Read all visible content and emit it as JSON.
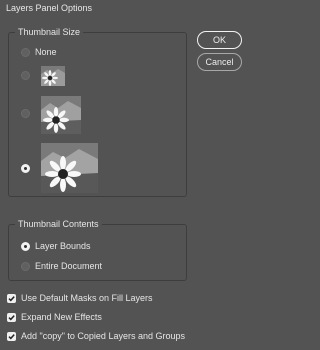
{
  "window": {
    "title": "Layers Panel Options"
  },
  "buttons": {
    "ok": "OK",
    "cancel": "Cancel"
  },
  "thumbnail_size": {
    "legend": "Thumbnail Size",
    "options": [
      {
        "label": "None",
        "selected": false
      },
      {
        "label": "",
        "selected": false,
        "size": "small"
      },
      {
        "label": "",
        "selected": false,
        "size": "medium"
      },
      {
        "label": "",
        "selected": true,
        "size": "large"
      }
    ]
  },
  "thumbnail_contents": {
    "legend": "Thumbnail Contents",
    "options": [
      {
        "label": "Layer Bounds",
        "selected": true
      },
      {
        "label": "Entire Document",
        "selected": false
      }
    ]
  },
  "checkboxes": [
    {
      "label": "Use Default Masks on Fill Layers",
      "checked": true
    },
    {
      "label": "Expand New Effects",
      "checked": true
    },
    {
      "label": "Add \"copy\" to Copied Layers and Groups",
      "checked": true
    }
  ],
  "colors": {
    "background": "#535353",
    "border": "#3e3e3e",
    "text": "#e6e6e6"
  }
}
